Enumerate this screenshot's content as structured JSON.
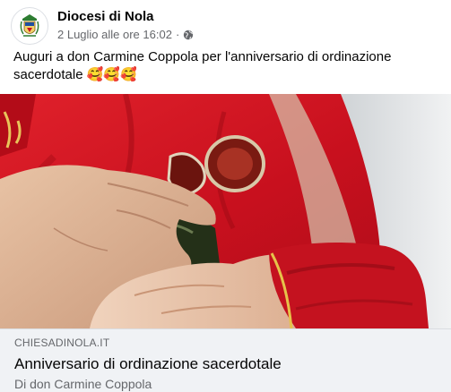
{
  "post": {
    "page_name": "Diocesi di Nola",
    "timestamp": "2 Luglio alle ore 16:02",
    "separator": "·",
    "privacy_icon": "globe-icon",
    "text": "Auguri a don Carmine Coppola per l'anniversario di ordinazione sacerdotale",
    "emojis": "🥰🥰🥰"
  },
  "link_preview": {
    "domain": "CHIESADINOLA.IT",
    "title": "Anniversario di ordinazione sacerdotale",
    "description": "Di don Carmine Coppola"
  },
  "colors": {
    "vestment_red": "#c8101e",
    "secondary_text": "#65676b",
    "footer_bg": "#f0f2f5"
  }
}
